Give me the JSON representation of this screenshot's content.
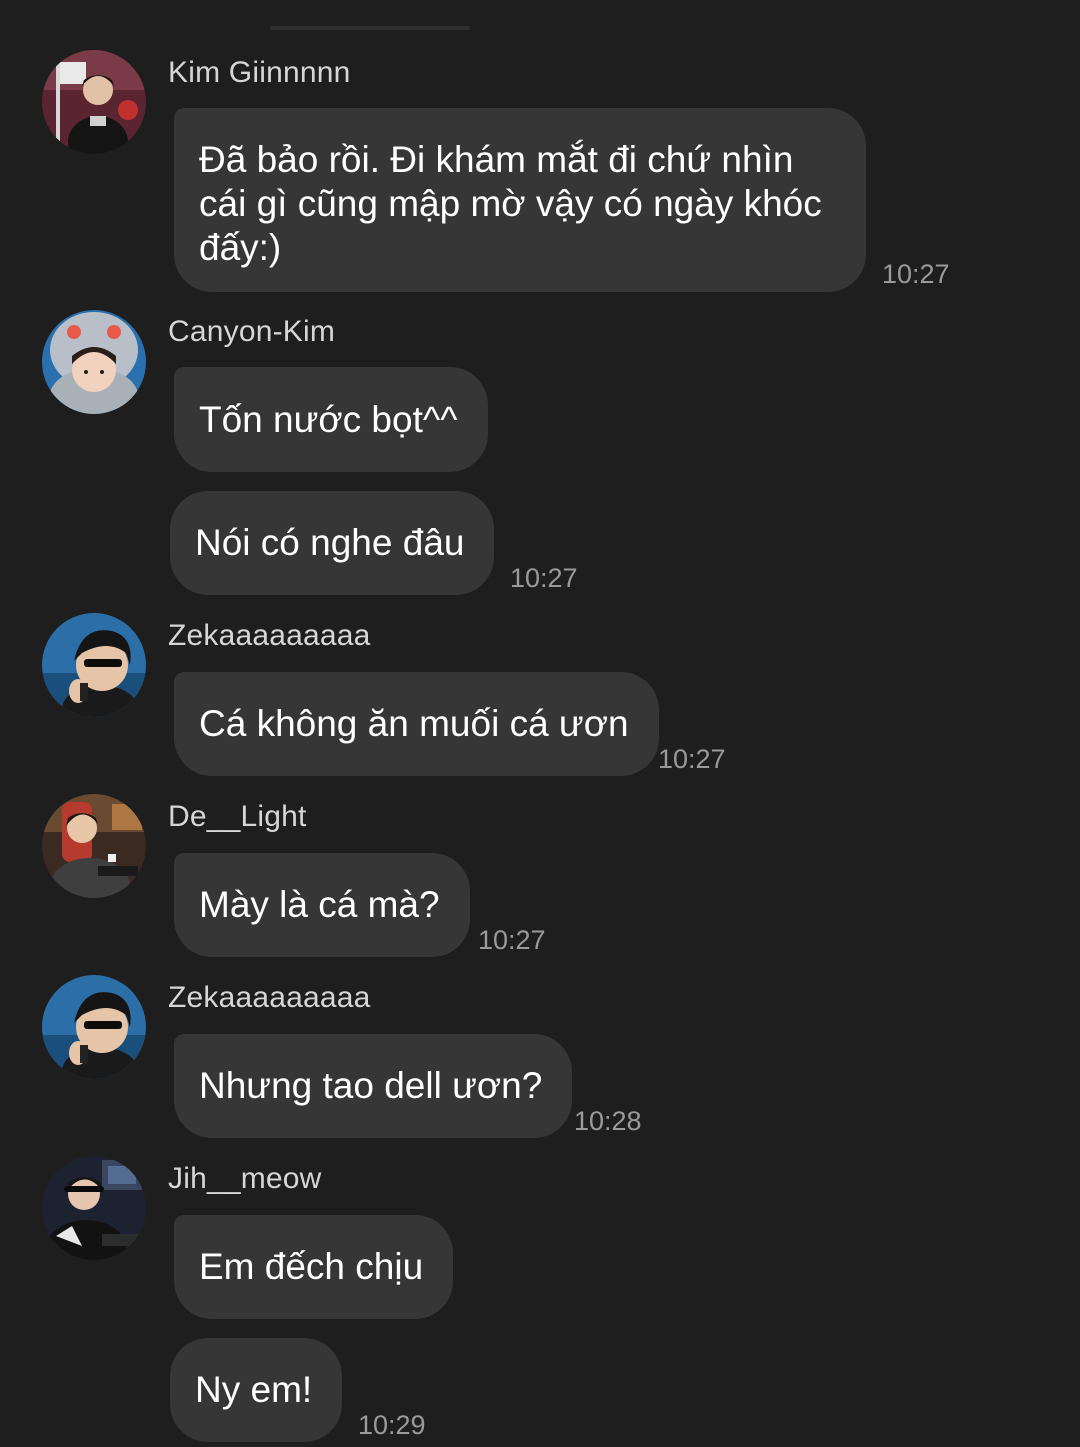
{
  "messages": [
    {
      "sender": "Kim Giinnnnn",
      "avatar_icon": "avatar-kim-giinnnnn",
      "bubbles": [
        "Đã bảo rồi. Đi khám mắt đi chứ nhìn cái gì cũng mập mờ vậy có ngày khóc đấy:)"
      ],
      "time": "10:27"
    },
    {
      "sender": "Canyon-Kim",
      "avatar_icon": "avatar-canyon-kim",
      "bubbles": [
        "Tốn nước bọt^^",
        "Nói có nghe đâu"
      ],
      "time": "10:27"
    },
    {
      "sender": "Zekaaaaaaaaa",
      "avatar_icon": "avatar-zekaaaaaaaaa",
      "bubbles": [
        "Cá không ăn muối cá ươn"
      ],
      "time": "10:27"
    },
    {
      "sender": "De__Light",
      "avatar_icon": "avatar-de-light",
      "bubbles": [
        "Mày là cá mà?"
      ],
      "time": "10:27"
    },
    {
      "sender": "Zekaaaaaaaaa",
      "avatar_icon": "avatar-zekaaaaaaaaa",
      "bubbles": [
        "Nhưng tao dell ươn?"
      ],
      "time": "10:28"
    },
    {
      "sender": "Jih__meow",
      "avatar_icon": "avatar-jih-meow",
      "bubbles": [
        "Em đếch chịu",
        "Ny em!"
      ],
      "time": "10:29"
    }
  ],
  "colors": {
    "background": "#1e1e1e",
    "bubble": "#363636",
    "sender_name": "#d6d6d6",
    "timestamp": "#9a9a9a"
  }
}
